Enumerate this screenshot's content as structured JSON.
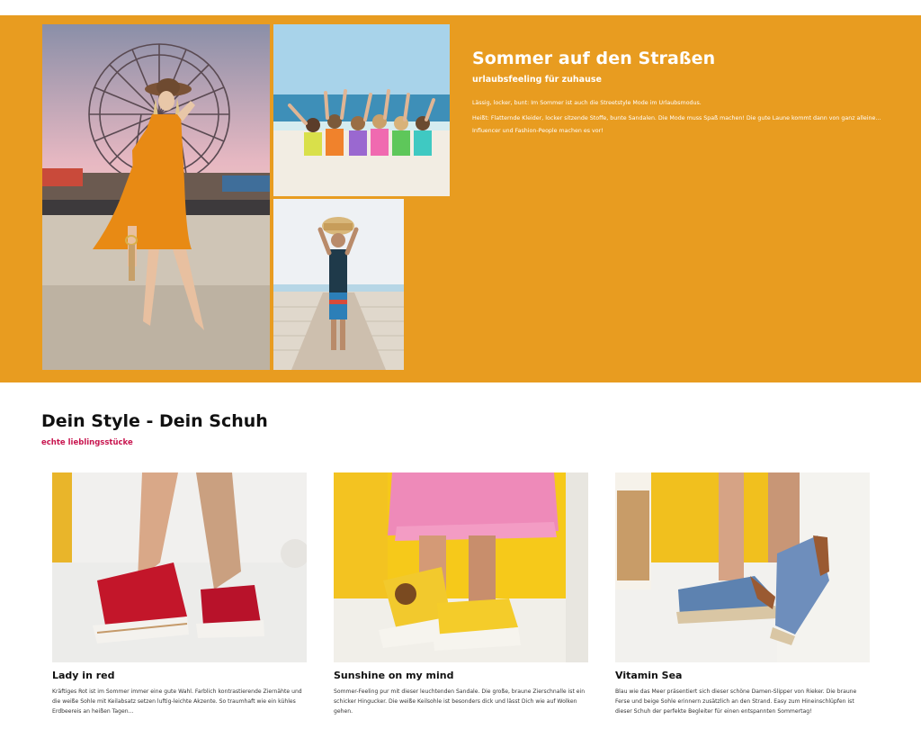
{
  "hero": {
    "title": "Sommer auf den Straßen",
    "subtitle": "urlaubsfeeling für zuhause",
    "paragraph1": "Lässig, locker, bunt: Im Sommer ist auch die Streetstyle Mode im Urlaubsmodus.",
    "paragraph2": "Heißt: Flatternde Kleider, locker sitzende Stoffe, bunte Sandalen. Die Mode muss Spaß machen! Die gute Laune kommt dann von ganz alleine... Influencer und Fashion-People machen es vor!",
    "background_color": "#e89c20"
  },
  "section": {
    "title": "Dein Style - Dein Schuh",
    "subtitle": "echte lieblingsstücke",
    "subtitle_color": "#c8154f"
  },
  "products": [
    {
      "title": "Lady in red",
      "description": "Kräftiges Rot ist im Sommer immer eine gute Wahl. Farblich kontrastierende Ziernähte und die weiße Sohle mit Keilabsatz setzen luftig-leichte Akzente. So traumhaft wie ein kühles Erdbeereis an heißen Tagen..."
    },
    {
      "title": "Sunshine on my mind",
      "description": "Sommer-Feeling pur mit dieser leuchtenden Sandale. Die große, braune Zierschnalle ist ein schicker Hingucker. Die weiße Keilsohle ist besonders dick und lässt Dich wie auf Wolken gehen."
    },
    {
      "title": "Vitamin Sea",
      "description": "Blau wie das Meer präsentiert sich dieser schöne Damen-Slipper von Rieker. Die braune Ferse und beige Sohle erinnern zusätzlich an den Strand. Easy zum Hineinschlüpfen ist dieser Schuh der perfekte Begleiter für einen entspannten Sommertag!"
    }
  ]
}
